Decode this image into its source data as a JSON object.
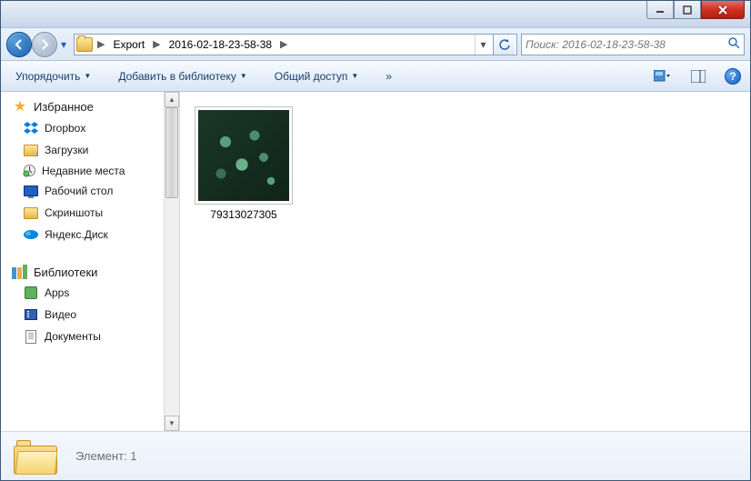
{
  "breadcrumb": {
    "item1": "Export",
    "item2": "2016-02-18-23-58-38"
  },
  "search": {
    "placeholder": "Поиск: 2016-02-18-23-58-38"
  },
  "toolbar": {
    "organize": "Упорядочить",
    "addToLibrary": "Добавить в библиотеку",
    "share": "Общий доступ",
    "overflow": "»"
  },
  "sidebar": {
    "favorites": "Избранное",
    "dropbox": "Dropbox",
    "downloads": "Загрузки",
    "recent": "Недавние места",
    "desktop": "Рабочий стол",
    "screenshots": "Скриншоты",
    "yandexdisk": "Яндекс.Диск",
    "libraries": "Библиотеки",
    "apps": "Apps",
    "video": "Видео",
    "documents": "Документы"
  },
  "files": {
    "item1_name": "79313027305"
  },
  "status": {
    "text": "Элемент: 1"
  }
}
